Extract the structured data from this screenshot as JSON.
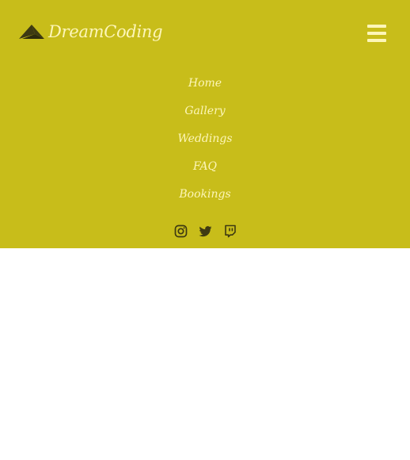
{
  "brand": {
    "name": "DreamCoding",
    "logo_icon": "paper-plane-logo-icon",
    "logo_color": "#3e3a12"
  },
  "colors": {
    "header_background": "#c8bd1a",
    "text": "#fdf6b8",
    "social_icon": "#3e3a12",
    "page_background": "#ffffff"
  },
  "menu_toggle": {
    "icon": "hamburger-menu-icon"
  },
  "nav": {
    "items": [
      {
        "label": "Home"
      },
      {
        "label": "Gallery"
      },
      {
        "label": "Weddings"
      },
      {
        "label": "FAQ"
      },
      {
        "label": "Bookings"
      }
    ]
  },
  "social": {
    "icons": [
      "instagram-icon",
      "twitter-icon",
      "twitch-icon"
    ]
  }
}
